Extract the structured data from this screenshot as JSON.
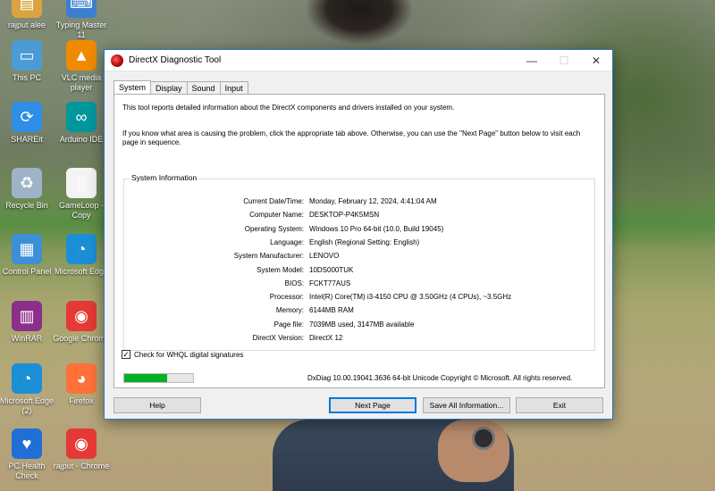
{
  "desktop": {
    "icons": [
      {
        "label": "rajput alee",
        "icon": "user-folder-icon",
        "color": "#d9a441"
      },
      {
        "label": "Typing Master 11",
        "icon": "typing-master-icon",
        "color": "#3c7fd1"
      },
      {
        "label": "This PC",
        "icon": "this-pc-icon",
        "color": "#4a9bd6"
      },
      {
        "label": "VLC media player",
        "icon": "vlc-icon",
        "color": "#f08a00"
      },
      {
        "label": "SHAREit",
        "icon": "shareit-icon",
        "color": "#2f8ee5"
      },
      {
        "label": "Arduino IDE",
        "icon": "arduino-icon",
        "color": "#00979c"
      },
      {
        "label": "Recycle Bin",
        "icon": "recycle-bin-icon",
        "color": "#9fb3c8"
      },
      {
        "label": "GameLoop - Copy",
        "icon": "file-icon",
        "color": "#f4f4f4"
      },
      {
        "label": "Control Panel",
        "icon": "control-panel-icon",
        "color": "#3d8fd8"
      },
      {
        "label": "Microsoft Edge",
        "icon": "edge-icon",
        "color": "#1b8fd6"
      },
      {
        "label": "WinRAR",
        "icon": "winrar-icon",
        "color": "#8b2f8a"
      },
      {
        "label": "Google Chrome",
        "icon": "chrome-icon",
        "color": "#e53935"
      },
      {
        "label": "Microsoft Edge (2)",
        "icon": "edge-icon",
        "color": "#1b8fd6"
      },
      {
        "label": "Firefox",
        "icon": "firefox-icon",
        "color": "#ff7139"
      },
      {
        "label": "PC Health Check",
        "icon": "pc-health-icon",
        "color": "#1f6fd6"
      },
      {
        "label": "rajput - Chrome",
        "icon": "chrome-icon",
        "color": "#e53935"
      }
    ]
  },
  "window": {
    "title": "DirectX Diagnostic Tool",
    "minimize": "—",
    "maximize": "☐",
    "close": "✕"
  },
  "tabs": [
    "System",
    "Display",
    "Sound",
    "Input"
  ],
  "intro": {
    "line1": "This tool reports detailed information about the DirectX components and drivers installed on your system.",
    "line2": "If you know what area is causing the problem, click the appropriate tab above.  Otherwise, you can use the \"Next Page\" button below to visit each page in sequence."
  },
  "system_info": {
    "legend": "System Information",
    "rows": [
      {
        "key": "Current Date/Time:",
        "value": "Monday, February 12, 2024, 4:41:04 AM"
      },
      {
        "key": "Computer Name:",
        "value": "DESKTOP-P4K5MSN"
      },
      {
        "key": "Operating System:",
        "value": "Windows 10 Pro 64-bit (10.0, Build 19045)"
      },
      {
        "key": "Language:",
        "value": "English (Regional Setting: English)"
      },
      {
        "key": "System Manufacturer:",
        "value": "LENOVO"
      },
      {
        "key": "System Model:",
        "value": "10DS000TUK"
      },
      {
        "key": "BIOS:",
        "value": "FCKT77AUS"
      },
      {
        "key": "Processor:",
        "value": "Intel(R) Core(TM) i3-4150 CPU @ 3.50GHz (4 CPUs), ~3.5GHz"
      },
      {
        "key": "Memory:",
        "value": "6144MB RAM"
      },
      {
        "key": "Page file:",
        "value": "7039MB used, 3147MB available"
      },
      {
        "key": "DirectX Version:",
        "value": "DirectX 12"
      }
    ]
  },
  "whql": {
    "label": "Check for WHQL digital signatures",
    "checked": true,
    "mark": "✓"
  },
  "progress": {
    "fraction": 0.62,
    "color": "#06b025"
  },
  "version_text": "DxDiag 10.00.19041.3636 64-bit Unicode  Copyright © Microsoft. All rights reserved.",
  "buttons": {
    "help": "Help",
    "next": "Next Page",
    "save": "Save All Information...",
    "exit": "Exit"
  }
}
